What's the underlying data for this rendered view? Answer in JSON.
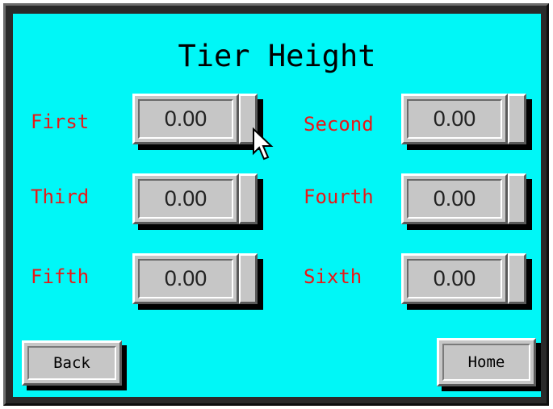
{
  "screen": {
    "title": "Tier Height",
    "background_color": "#00f7f7",
    "label_color": "#e81818"
  },
  "tiers": [
    {
      "label": "First",
      "value": "0.00"
    },
    {
      "label": "Second",
      "value": "0.00"
    },
    {
      "label": "Third",
      "value": "0.00"
    },
    {
      "label": "Fourth",
      "value": "0.00"
    },
    {
      "label": "Fifth",
      "value": "0.00"
    },
    {
      "label": "Sixth",
      "value": "0.00"
    }
  ],
  "nav": {
    "back_label": "Back",
    "home_label": "Home"
  },
  "cursor": {
    "icon": "mouse-pointer-icon"
  }
}
